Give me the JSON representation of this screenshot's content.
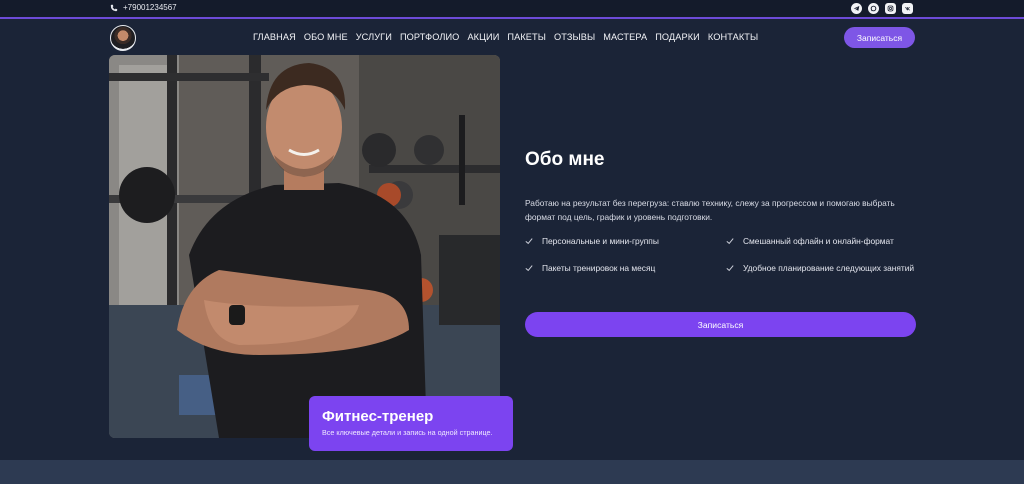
{
  "topbar": {
    "phone": "+79001234567",
    "socials": [
      "telegram-icon",
      "max-icon",
      "instagram-icon",
      "vk-icon"
    ]
  },
  "nav": {
    "menu": [
      "ГЛАВНАЯ",
      "ОБО МНЕ",
      "УСЛУГИ",
      "ПОРТФОЛИО",
      "АКЦИИ",
      "ПАКЕТЫ",
      "ОТЗЫВЫ",
      "МАСТЕРА",
      "ПОДАРКИ",
      "КОНТАКТЫ"
    ],
    "cta": "Записаться"
  },
  "badge": {
    "title": "Фитнес-тренер",
    "subtitle": "Все ключевые детали и запись на одной странице."
  },
  "about": {
    "title": "Обо мне",
    "text": "Работаю на результат без перегруза: ставлю технику, слежу за прогрессом и помогаю выбрать формат под цель, график и уровень подготовки.",
    "features": [
      "Персональные и мини-группы",
      "Смешанный офлайн и онлайн-формат",
      "Пакеты тренировок на месяц",
      "Удобное планирование следующих занятий"
    ],
    "cta": "Записаться"
  },
  "colors": {
    "accent": "#7c44f0",
    "background": "#1b2437",
    "topbar": "#141b2b"
  }
}
